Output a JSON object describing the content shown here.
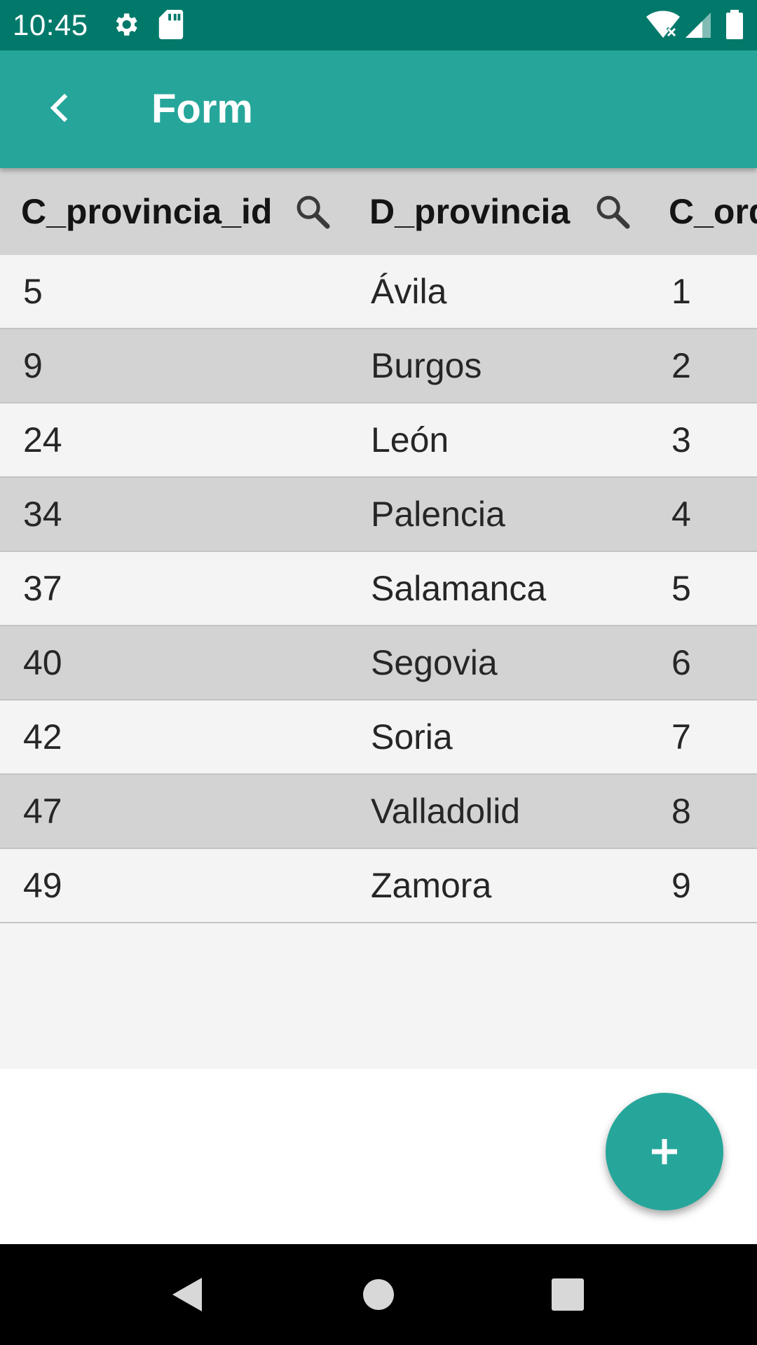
{
  "status_bar": {
    "time": "10:45",
    "icons": [
      "gear-icon",
      "sd-card-icon",
      "wifi-off-icon",
      "signal-icon",
      "battery-icon"
    ]
  },
  "app_bar": {
    "title": "Form",
    "back_icon": "chevron-left-icon"
  },
  "table": {
    "columns": [
      {
        "label": "C_provincia_id",
        "searchable": true
      },
      {
        "label": "D_provincia",
        "searchable": true
      },
      {
        "label": "C_ord",
        "searchable": false
      }
    ],
    "rows": [
      [
        "5",
        "Ávila",
        "1"
      ],
      [
        "9",
        "Burgos",
        "2"
      ],
      [
        "24",
        "León",
        "3"
      ],
      [
        "34",
        "Palencia",
        "4"
      ],
      [
        "37",
        "Salamanca",
        "5"
      ],
      [
        "40",
        "Segovia",
        "6"
      ],
      [
        "42",
        "Soria",
        "7"
      ],
      [
        "47",
        "Valladolid",
        "8"
      ],
      [
        "49",
        "Zamora",
        "9"
      ]
    ]
  },
  "fab": {
    "icon": "plus-icon"
  },
  "nav_bar": {
    "icons": [
      "back-triangle-icon",
      "home-circle-icon",
      "recents-square-icon"
    ]
  },
  "colors": {
    "status_bar": "#00796b",
    "app_bar": "#26a69a",
    "row_light": "#f4f4f4",
    "row_dark": "#d3d3d3"
  }
}
